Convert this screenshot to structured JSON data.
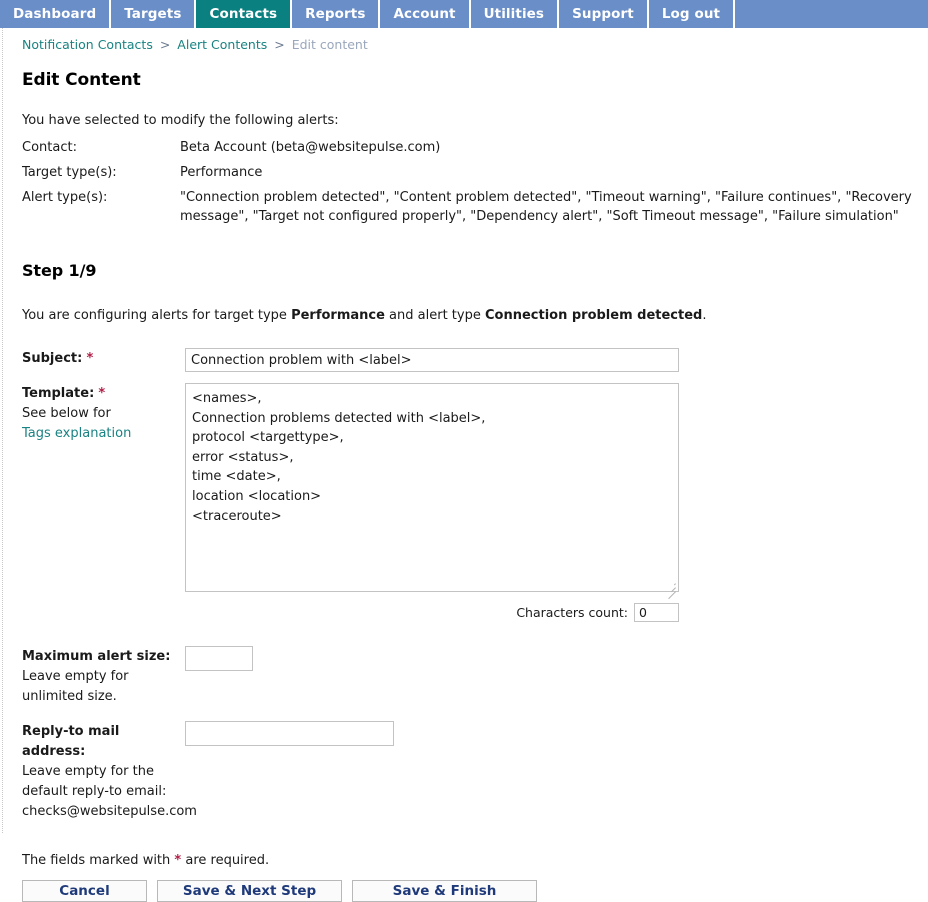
{
  "nav": {
    "tabs": [
      {
        "label": "Dashboard",
        "active": false
      },
      {
        "label": "Targets",
        "active": false
      },
      {
        "label": "Contacts",
        "active": true
      },
      {
        "label": "Reports",
        "active": false
      },
      {
        "label": "Account",
        "active": false
      },
      {
        "label": "Utilities",
        "active": false
      },
      {
        "label": "Support",
        "active": false
      },
      {
        "label": "Log out",
        "active": false
      }
    ],
    "active_color": "#0b8080",
    "background_color": "#6a8ec8"
  },
  "breadcrumb": {
    "items": [
      {
        "label": "Notification Contacts",
        "current": false
      },
      {
        "label": "Alert Contents",
        "current": false
      },
      {
        "label": "Edit content",
        "current": true
      }
    ],
    "separator": ">",
    "link_color": "#1a8282",
    "current_color": "#9aa7bb"
  },
  "page": {
    "title": "Edit Content",
    "intro": "You have selected to modify the following alerts:",
    "info": [
      {
        "label": "Contact:",
        "value": "Beta Account (beta@websitepulse.com)"
      },
      {
        "label": "Target type(s):",
        "value": "Performance"
      },
      {
        "label": "Alert type(s):",
        "value": "\"Connection problem detected\", \"Content problem detected\", \"Timeout warning\", \"Failure continues\", \"Recovery message\", \"Target not configured properly\", \"Dependency alert\", \"Soft Timeout message\", \"Failure simulation\""
      }
    ],
    "step_title": "Step 1/9",
    "configuring_prefix": "You are configuring alerts for target type ",
    "configuring_target_type": "Performance",
    "configuring_middle": " and alert type ",
    "configuring_alert_type": "Connection problem detected",
    "configuring_suffix": "."
  },
  "form": {
    "subject": {
      "label": "Subject:",
      "required_mark": "*",
      "value": "Connection problem with <label>",
      "placeholder": ""
    },
    "template": {
      "label": "Template:",
      "required_mark": "*",
      "note": "See below for",
      "link_label": "Tags explanation",
      "value": "<names>,\nConnection problems detected with <label>,\nprotocol <targettype>,\nerror <status>,\ntime <date>,\nlocation <location>\n<traceroute>",
      "placeholder": ""
    },
    "characters_count": {
      "label": "Characters count:",
      "value": "0"
    },
    "maximum_alert_size": {
      "label": "Maximum alert size:",
      "note_line1": "Leave empty for",
      "note_line2": "unlimited size.",
      "value": "",
      "placeholder": ""
    },
    "reply_to": {
      "label": "Reply-to mail address:",
      "note_line1": "Leave empty for the",
      "note_line2": "default reply-to email:",
      "note_line3": "checks@websitepulse.com",
      "value": "",
      "placeholder": ""
    }
  },
  "footer": {
    "required_note_prefix": "The fields marked with ",
    "required_note_mark": "*",
    "required_note_suffix": " are required.",
    "buttons": {
      "cancel": "Cancel",
      "save_next": "Save & Next Step",
      "save_finish": "Save & Finish"
    },
    "button_text_color": "#1f3a7a"
  }
}
